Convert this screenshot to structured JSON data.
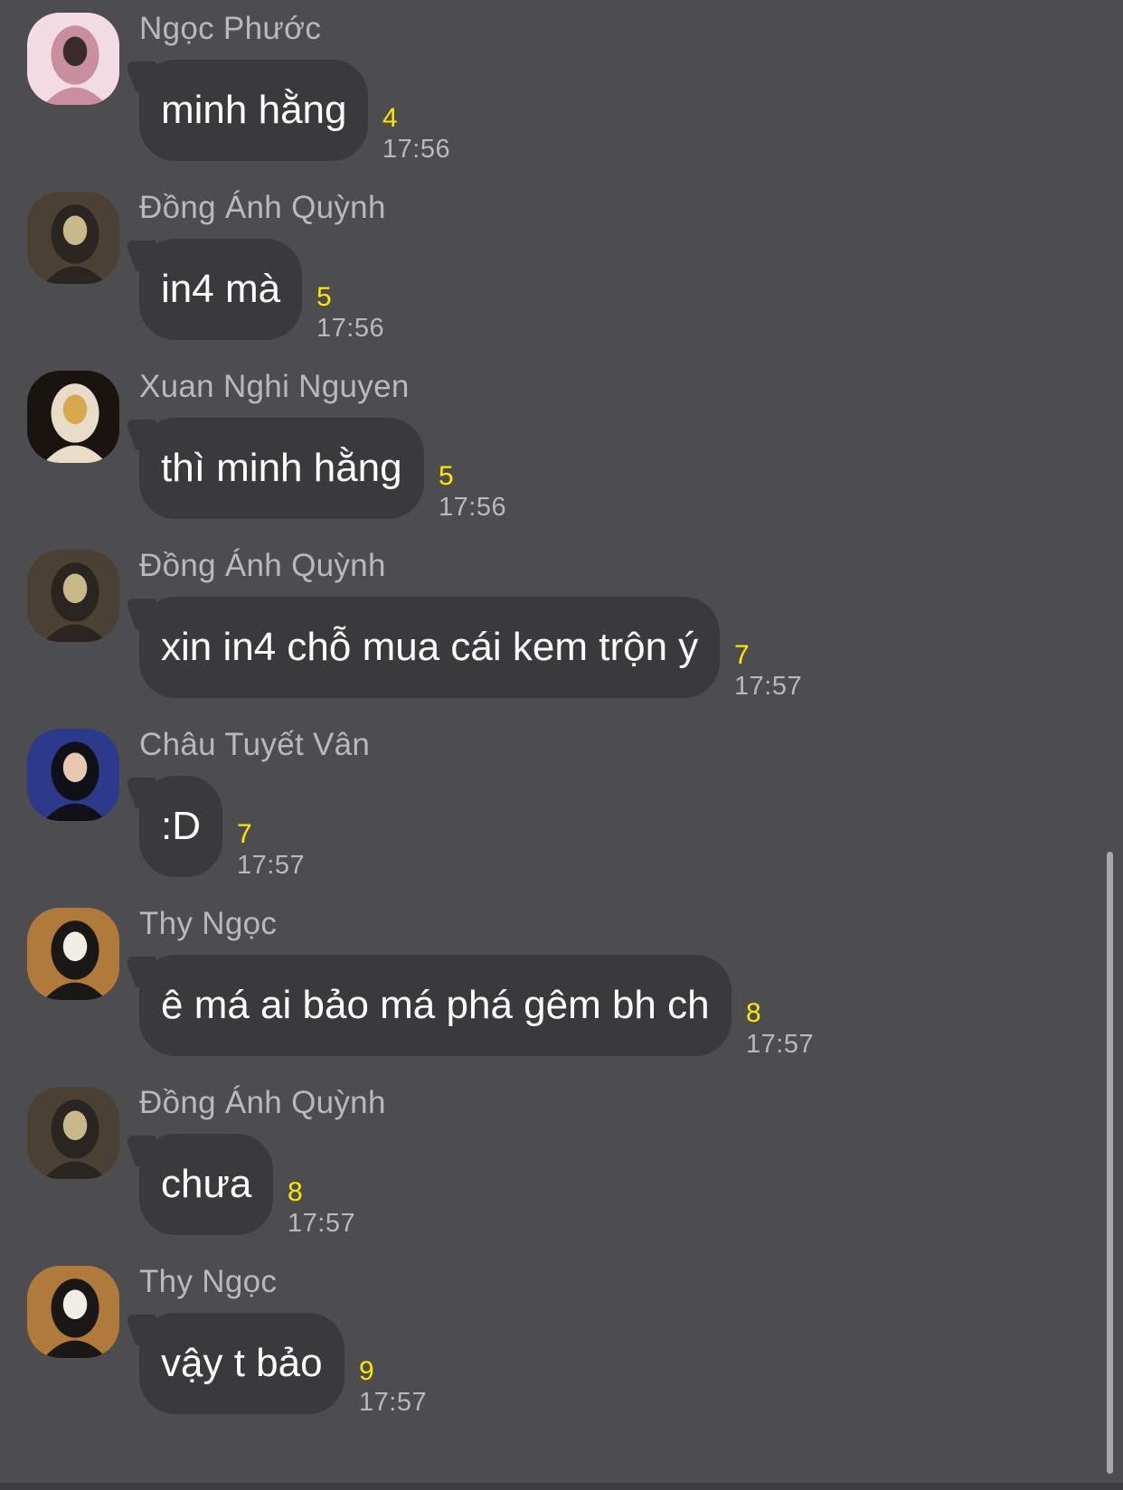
{
  "chat": {
    "messages": [
      {
        "sender": "Ngọc Phước",
        "text": "minh hằng",
        "reads": "4",
        "time": "17:56",
        "avatar_icon": "avatar-girl-pink",
        "avatar_colors": [
          "#f3dbe3",
          "#c98f9f",
          "#3a2a2e"
        ]
      },
      {
        "sender": "Đồng Ánh Quỳnh",
        "text": "in4 mà",
        "reads": "5",
        "time": "17:56",
        "avatar_icon": "avatar-girl-dark",
        "avatar_colors": [
          "#4a4134",
          "#2a2520",
          "#c8b88a"
        ]
      },
      {
        "sender": "Xuan Nghi Nguyen",
        "text": "thì minh hằng",
        "reads": "5",
        "time": "17:56",
        "avatar_icon": "avatar-girl-furcoat",
        "avatar_colors": [
          "#1a1410",
          "#e8dcc8",
          "#d8a850"
        ]
      },
      {
        "sender": "Đồng Ánh Quỳnh",
        "text": "xin in4 chỗ mua cái kem trộn ý",
        "reads": "7",
        "time": "17:57",
        "avatar_icon": "avatar-girl-dark",
        "avatar_colors": [
          "#4a4134",
          "#2a2520",
          "#c8b88a"
        ]
      },
      {
        "sender": "Châu Tuyết Vân",
        "text": ":D",
        "reads": "7",
        "time": "17:57",
        "avatar_icon": "avatar-girl-blue",
        "avatar_colors": [
          "#2d3a8c",
          "#101018",
          "#e8c8b0"
        ]
      },
      {
        "sender": "Thy Ngọc",
        "text": "ê má ai bảo má phá gêm bh ch",
        "reads": "8",
        "time": "17:57",
        "avatar_icon": "avatar-girl-car",
        "avatar_colors": [
          "#b07a3a",
          "#1a1816",
          "#f0ece6"
        ]
      },
      {
        "sender": "Đồng Ánh Quỳnh",
        "text": "chưa",
        "reads": "8",
        "time": "17:57",
        "avatar_icon": "avatar-girl-dark",
        "avatar_colors": [
          "#4a4134",
          "#2a2520",
          "#c8b88a"
        ]
      },
      {
        "sender": "Thy Ngọc",
        "text": "vậy t bảo",
        "reads": "9",
        "time": "17:57",
        "avatar_icon": "avatar-girl-car",
        "avatar_colors": [
          "#b07a3a",
          "#1a1816",
          "#f0ece6"
        ]
      }
    ]
  },
  "colors": {
    "background": "#4d4d4f",
    "bubble": "#3a3a3c",
    "bubble_text": "#ffffff",
    "read_count": "#ffe600",
    "secondary_text": "#b9b9bb"
  }
}
